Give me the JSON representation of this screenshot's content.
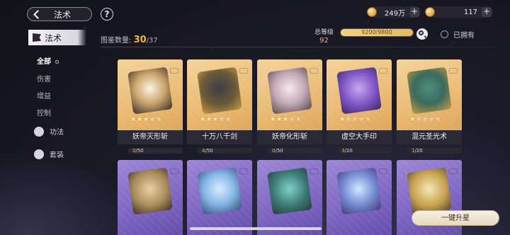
{
  "header": {
    "back_label": "法术",
    "help_label": "?"
  },
  "resources": [
    {
      "icon": "gold-coin-icon",
      "value": "249万"
    },
    {
      "icon": "spirit-coin-icon",
      "value": "117"
    }
  ],
  "sidebar": {
    "active_tab": "法术",
    "items": [
      {
        "label": "全部",
        "selected": true
      },
      {
        "label": "伤害"
      },
      {
        "label": "增益"
      },
      {
        "label": "控制"
      }
    ],
    "icon_items": [
      {
        "label": "功法",
        "icon": "technique-icon"
      },
      {
        "label": "套装",
        "icon": "set-icon"
      }
    ]
  },
  "collection": {
    "label": "图鉴数量:",
    "current": "30",
    "total": "/37"
  },
  "level": {
    "label": "总等级",
    "value": "92",
    "exp_text": "9200/9800"
  },
  "owned_filter": {
    "label": "已拥有"
  },
  "cards": [
    {
      "name": "妖帝灭形斩",
      "progress": "0",
      "max": "/50",
      "stars": 3,
      "rarity": "gold",
      "art": "a1"
    },
    {
      "name": "十万八千剑",
      "progress": "4",
      "max": "/50",
      "stars": 3,
      "rarity": "gold",
      "art": "a2"
    },
    {
      "name": "妖帝化形斩",
      "progress": "0",
      "max": "/50",
      "stars": 3,
      "rarity": "gold",
      "art": "a3"
    },
    {
      "name": "虚空大手印",
      "progress": "3",
      "max": "/20",
      "stars": 1,
      "rarity": "gold",
      "art": "a4"
    },
    {
      "name": "混元圣光术",
      "progress": "1",
      "max": "/20",
      "stars": 1,
      "rarity": "gold",
      "art": "a5"
    },
    {
      "rarity": "purple",
      "art": "b1"
    },
    {
      "rarity": "purple",
      "art": "b2"
    },
    {
      "rarity": "purple",
      "art": "b3"
    },
    {
      "rarity": "purple",
      "art": "b4"
    },
    {
      "rarity": "purple",
      "art": "b5"
    }
  ],
  "actions": {
    "upgrade_all": "一键升星"
  }
}
